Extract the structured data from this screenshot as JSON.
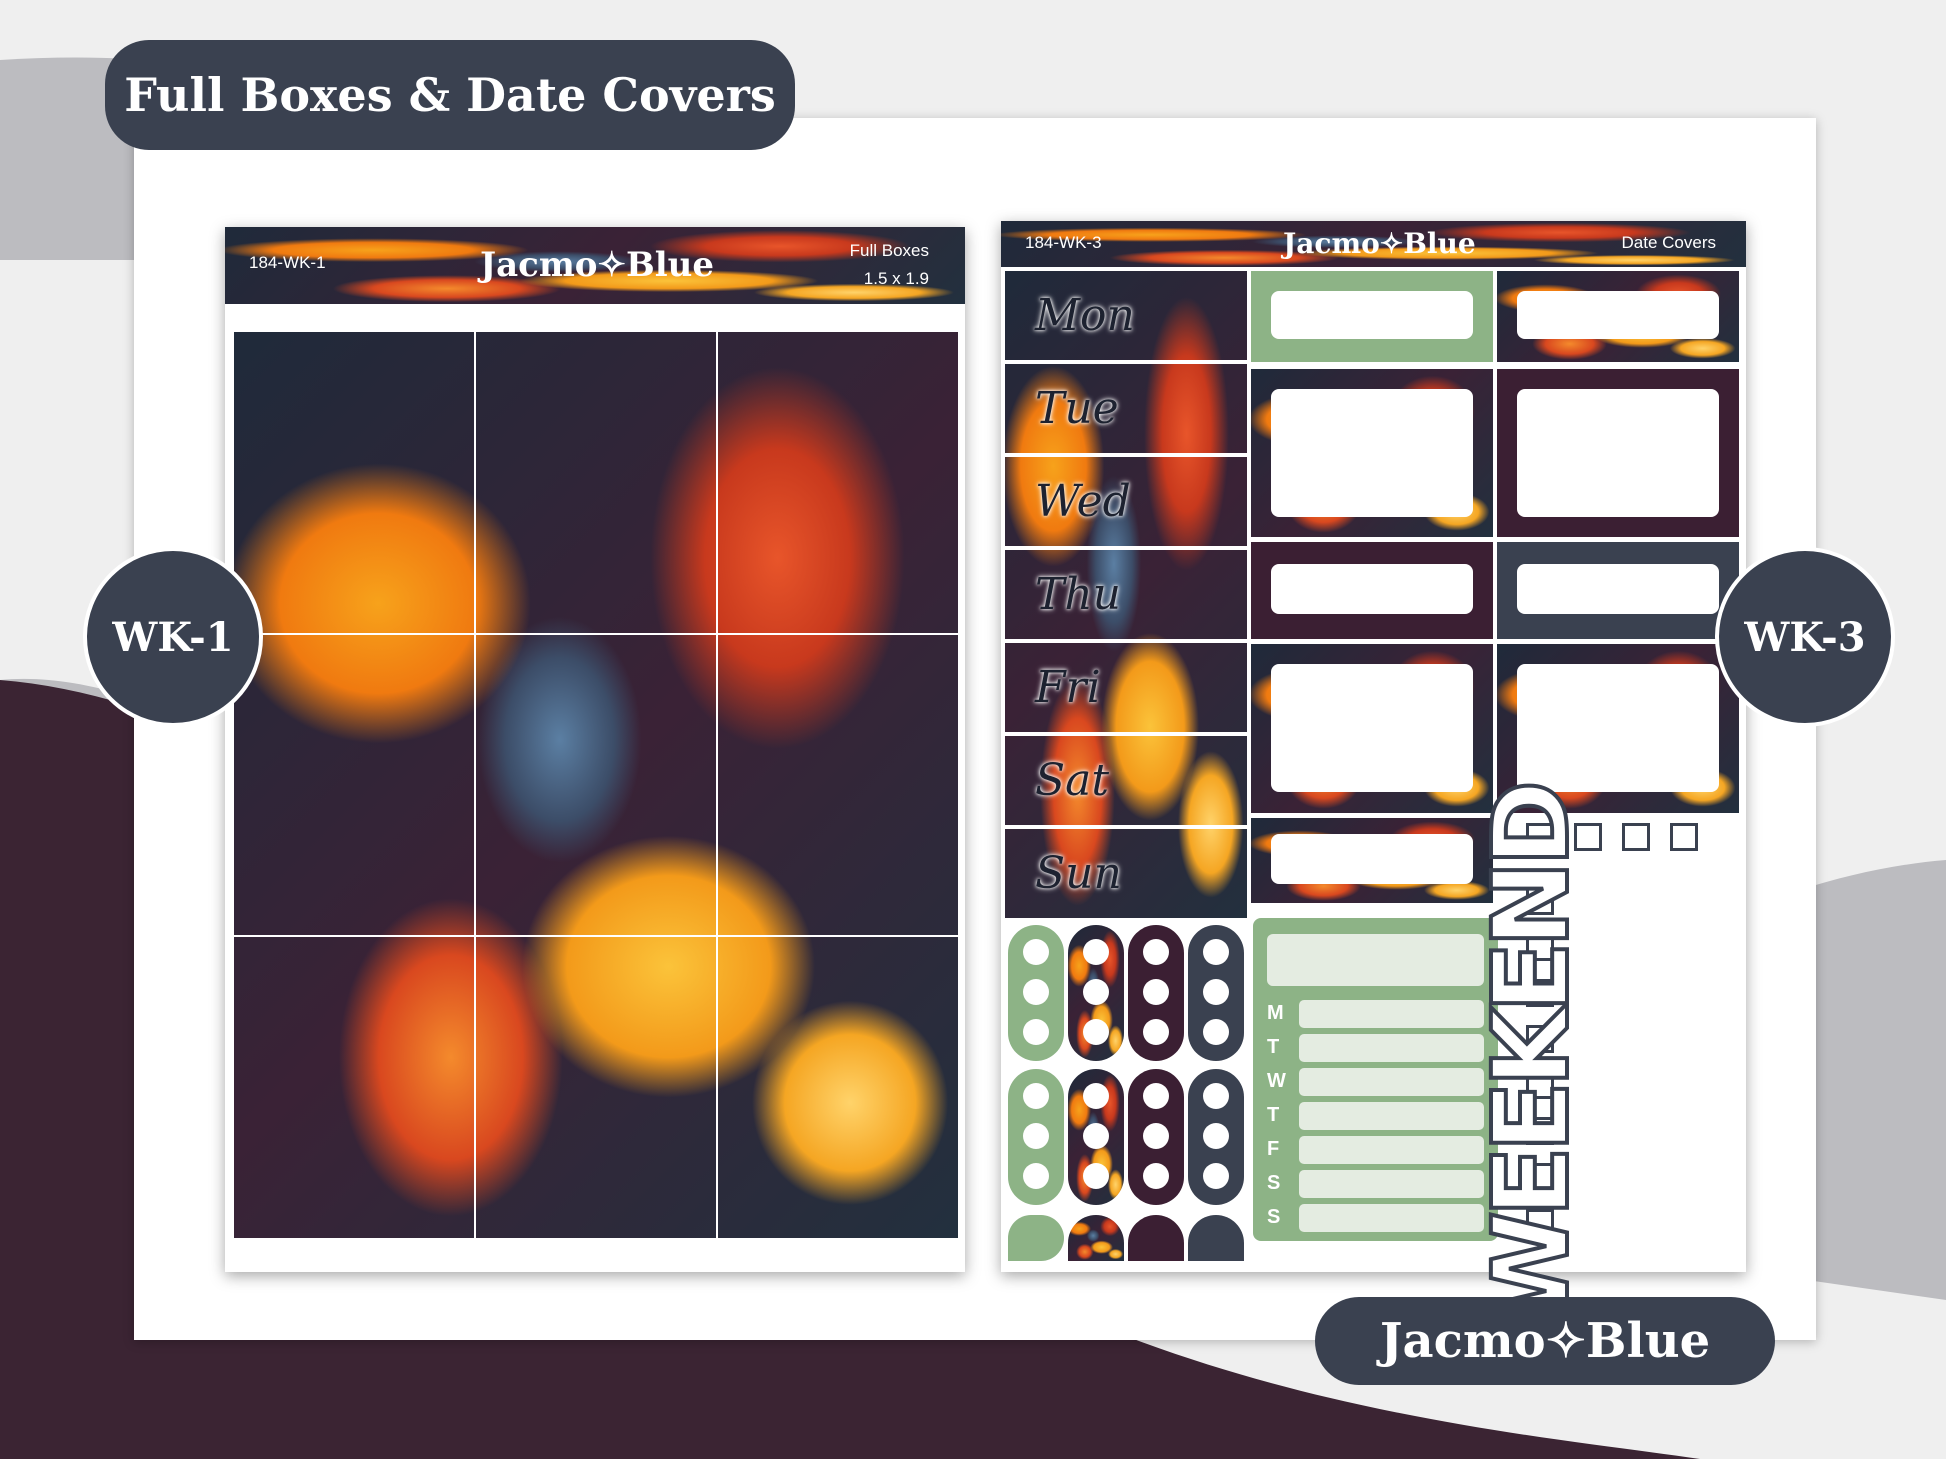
{
  "banner": {
    "title": "Full Boxes & Date Covers"
  },
  "labels": {
    "left": "WK-1",
    "right": "WK-3"
  },
  "brand": {
    "logo": "Jacmo✧Blue"
  },
  "sheet_left": {
    "code": "184-WK-1",
    "logo": "Jacmo✧Blue",
    "type": "Full Boxes",
    "size": "1.5 x 1.9"
  },
  "sheet_right": {
    "code": "184-WK-3",
    "logo": "Jacmo✧Blue",
    "type": "Date Covers",
    "days": [
      "Mon",
      "Tue",
      "Wed",
      "Thu",
      "Fri",
      "Sat",
      "Sun"
    ],
    "tracker_letters": [
      "M",
      "T",
      "W",
      "T",
      "F",
      "S",
      "S"
    ],
    "weekend": "WEEKEND"
  },
  "colors": {
    "green": "#8db386",
    "plum": "#3b1f33",
    "navy": "#3a4150",
    "background_dark": "#3b2433"
  }
}
